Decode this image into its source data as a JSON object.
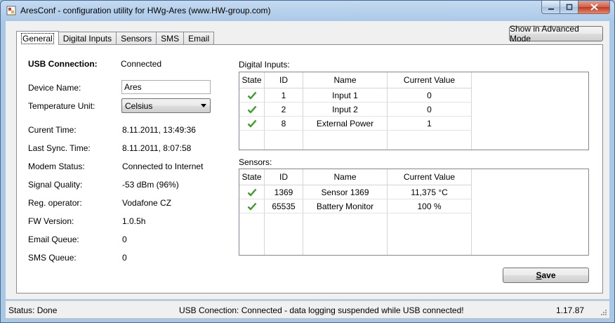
{
  "window": {
    "title": "AresConf - configuration utility for HWg-Ares (www.HW-group.com)"
  },
  "tabs": [
    {
      "label": "General"
    },
    {
      "label": "Digital Inputs"
    },
    {
      "label": "Sensors"
    },
    {
      "label": "SMS"
    },
    {
      "label": "Email"
    }
  ],
  "toolbar": {
    "advanced_label": "Show in Advanced Mode"
  },
  "general": {
    "usb_label": "USB Connection:",
    "usb_value": "Connected",
    "device_name_label": "Device Name:",
    "device_name_value": "Ares",
    "temp_unit_label": "Temperature Unit:",
    "temp_unit_value": "Celsius",
    "fields": [
      {
        "label": "Curent Time:",
        "value": "8.11.2011, 13:49:36"
      },
      {
        "label": "Last Sync. Time:",
        "value": "8.11.2011, 8:07:58"
      },
      {
        "label": "Modem Status:",
        "value": "Connected to Internet"
      },
      {
        "label": "Signal Quality:",
        "value": "-53 dBm (96%)"
      },
      {
        "label": "Reg. operator:",
        "value": "Vodafone CZ"
      },
      {
        "label": "FW Version:",
        "value": "1.0.5h"
      },
      {
        "label": "Email Queue:",
        "value": "0"
      },
      {
        "label": "SMS Queue:",
        "value": "0"
      }
    ]
  },
  "digital_inputs": {
    "title": "Digital Inputs:",
    "columns": [
      "State",
      "ID",
      "Name",
      "Current Value"
    ],
    "rows": [
      {
        "state": "ok",
        "id": "1",
        "name": "Input 1",
        "value": "0"
      },
      {
        "state": "ok",
        "id": "2",
        "name": "Input 2",
        "value": "0"
      },
      {
        "state": "ok",
        "id": "8",
        "name": "External Power",
        "value": "1"
      }
    ]
  },
  "sensors": {
    "title": "Sensors:",
    "columns": [
      "State",
      "ID",
      "Name",
      "Current Value"
    ],
    "rows": [
      {
        "state": "ok",
        "id": "1369",
        "name": "Sensor 1369",
        "value": "11,375 °C"
      },
      {
        "state": "ok",
        "id": "65535",
        "name": "Battery Monitor",
        "value": "100 %"
      }
    ]
  },
  "actions": {
    "save_mnemonic": "S",
    "save_rest": "ave"
  },
  "statusbar": {
    "status": "Status:  Done",
    "usb": "USB Conection:  Connected - data logging suspended while USB connected!",
    "version": "1.17.87"
  },
  "icons": {
    "app": "app-icon",
    "check": "check-icon",
    "minimize": "minimize-icon",
    "maximize": "maximize-icon",
    "close": "close-icon"
  },
  "colors": {
    "check_green": "#3d9a2a",
    "title_bar": "#a9c8e6"
  }
}
